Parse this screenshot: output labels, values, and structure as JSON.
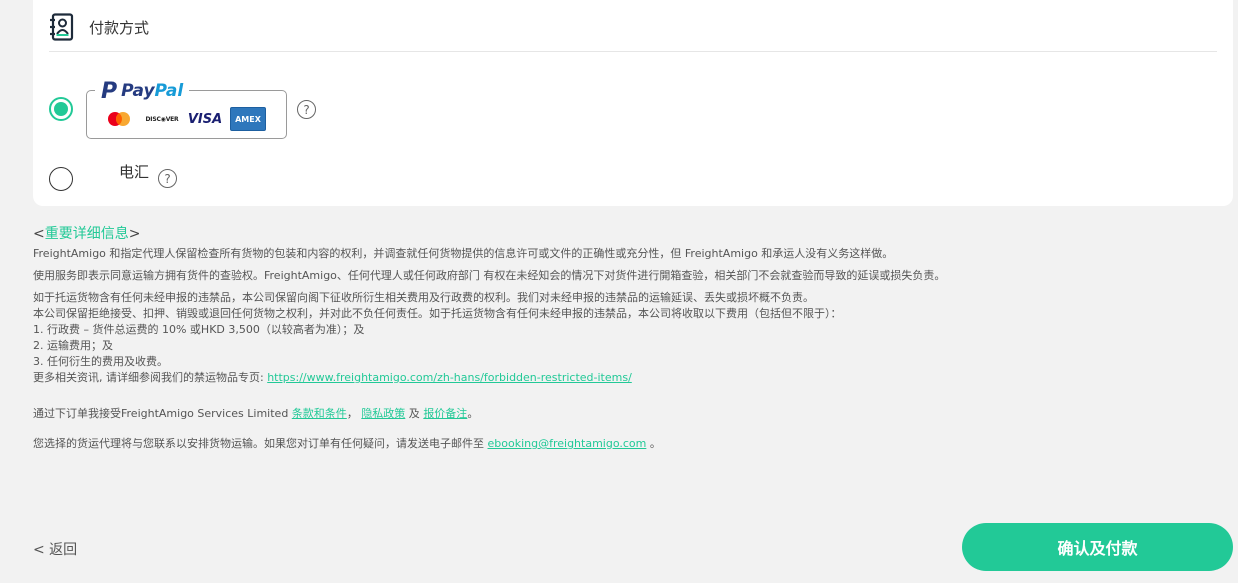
{
  "payment": {
    "title": "付款方式",
    "paypal": {
      "word_pay": "Pay",
      "word_pal": "Pal",
      "selected": true
    },
    "cards": {
      "discover": "DISC◉VER",
      "visa": "VISA",
      "amex": "AMEX"
    },
    "help": "?",
    "wire": {
      "label": "电汇",
      "selected": false
    }
  },
  "info": {
    "title_open": "<",
    "title_text": "重要详细信息",
    "title_close": ">",
    "p1": "FreightAmigo 和指定代理人保留检查所有货物的包装和内容的权利，并调查就任何货物提供的信息许可或文件的正确性或充分性，但 FreightAmigo 和承运人没有义务这样做。",
    "p2": "使用服务即表示同意运输方拥有货件的查验权。FreightAmigo、任何代理人或任何政府部门 有权在未经知会的情况下对货件进行開箱查验，相关部门不会就查验而导致的延误或损失负责。",
    "p3_lines": [
      "如于托运货物含有任何未经申报的违禁品，本公司保留向阁下征收所衍生相关费用及行政费的权利。我们对未经申报的违禁品的运输延误、丢失或损坏概不负责。",
      "本公司保留拒绝接受、扣押、销毁或退回任何货物之权利，并对此不负任何责任。如于托运货物含有任何未经申报的违禁品，本公司将收取以下费用（包括但不限于）：",
      "1. 行政费 – 货件总运费的 10% 或HKD 3,500（以较高者为准）；及",
      "2. 运输费用；及",
      "3. 任何衍生的费用及收费。"
    ],
    "more_prefix": "更多相关资讯, 请详细参阅我们的禁运物品专页: ",
    "more_link": "https://www.freightamigo.com/zh-hans/forbidden-restricted-items/",
    "terms_prefix": "通过下订单我接受FreightAmigo Services Limited ",
    "terms_link": "条款和条件",
    "terms_sep": "，",
    "privacy_link": "隐私政策",
    "terms_and": " 及 ",
    "quote_link": "报价备注",
    "terms_end": "。",
    "contact_prefix": "您选择的货运代理将与您联系以安排货物运输。如果您对订单有任何疑问，请发送电子邮件至 ",
    "contact_email": "ebooking@freightamigo.com",
    "contact_end": " 。"
  },
  "footer": {
    "back_label": "< 返回",
    "confirm_label": "确认及付款",
    "accent_color": "#22c997"
  }
}
